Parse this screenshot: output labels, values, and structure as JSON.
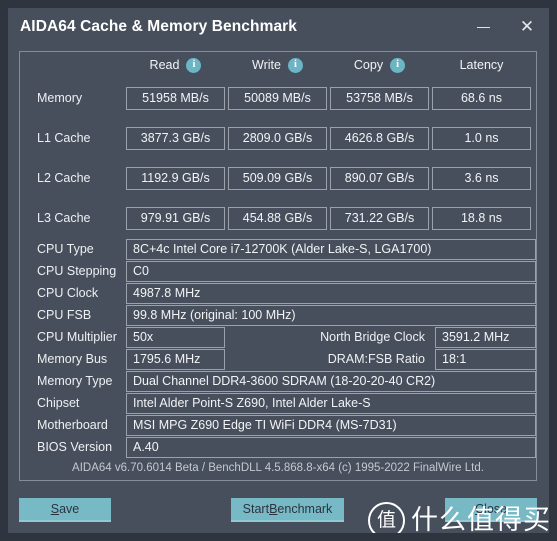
{
  "window": {
    "title": "AIDA64 Cache & Memory Benchmark",
    "minimize_label": "minimize",
    "close_label": "close"
  },
  "benchmark": {
    "headers": [
      "Read",
      "Write",
      "Copy",
      "Latency"
    ],
    "header_icons": [
      "info-icon",
      "info-icon",
      "info-icon"
    ],
    "rows": [
      {
        "label": "Memory",
        "read": "51958 MB/s",
        "write": "50089 MB/s",
        "copy": "53758 MB/s",
        "latency": "68.6 ns"
      },
      {
        "label": "L1 Cache",
        "read": "3877.3 GB/s",
        "write": "2809.0 GB/s",
        "copy": "4626.8 GB/s",
        "latency": "1.0 ns"
      },
      {
        "label": "L2 Cache",
        "read": "1192.9 GB/s",
        "write": "509.09 GB/s",
        "copy": "890.07 GB/s",
        "latency": "3.6 ns"
      },
      {
        "label": "L3 Cache",
        "read": "979.91 GB/s",
        "write": "454.88 GB/s",
        "copy": "731.22 GB/s",
        "latency": "18.8 ns"
      }
    ]
  },
  "cpu_info": {
    "type_label": "CPU Type",
    "type_value": "8C+4c Intel Core i7-12700K  (Alder Lake-S, LGA1700)",
    "stepping_label": "CPU Stepping",
    "stepping_value": "C0",
    "clock_label": "CPU Clock",
    "clock_value": "4987.8 MHz",
    "fsb_label": "CPU FSB",
    "fsb_value": "99.8 MHz  (original: 100 MHz)",
    "multiplier_label": "CPU Multiplier",
    "multiplier_value": "50x",
    "north_bridge_label": "North Bridge Clock",
    "north_bridge_value": "3591.2 MHz"
  },
  "memory_info": {
    "bus_label": "Memory Bus",
    "bus_value": "1795.6 MHz",
    "ratio_label": "DRAM:FSB Ratio",
    "ratio_value": "18:1",
    "type_label": "Memory Type",
    "type_value": "Dual Channel DDR4-3600 SDRAM  (18-20-20-40 CR2)",
    "chipset_label": "Chipset",
    "chipset_value": "Intel Alder Point-S Z690, Intel Alder Lake-S",
    "motherboard_label": "Motherboard",
    "motherboard_value": "MSI MPG Z690 Edge TI WiFi DDR4 (MS-7D31)",
    "bios_label": "BIOS Version",
    "bios_value": "A.40"
  },
  "footer": {
    "note": "AIDA64 v6.70.6014 Beta / BenchDLL 4.5.868.8-x64  (c) 1995-2022 FinalWire Ltd."
  },
  "buttons": {
    "save": {
      "prefix": "",
      "accel": "S",
      "suffix": "ave"
    },
    "start": {
      "prefix": "Start ",
      "accel": "B",
      "suffix": "enchmark"
    },
    "close": {
      "prefix": "",
      "accel": "C",
      "suffix": "lose"
    }
  },
  "watermark": {
    "logo_char": "值",
    "text": "什么值得买"
  },
  "colors": {
    "window_bg": "#474f5c",
    "outer_bg": "#2f353e",
    "accent_teal": "#78b9c6",
    "border": "#9aa1ab",
    "text": "#f2f4f6"
  }
}
